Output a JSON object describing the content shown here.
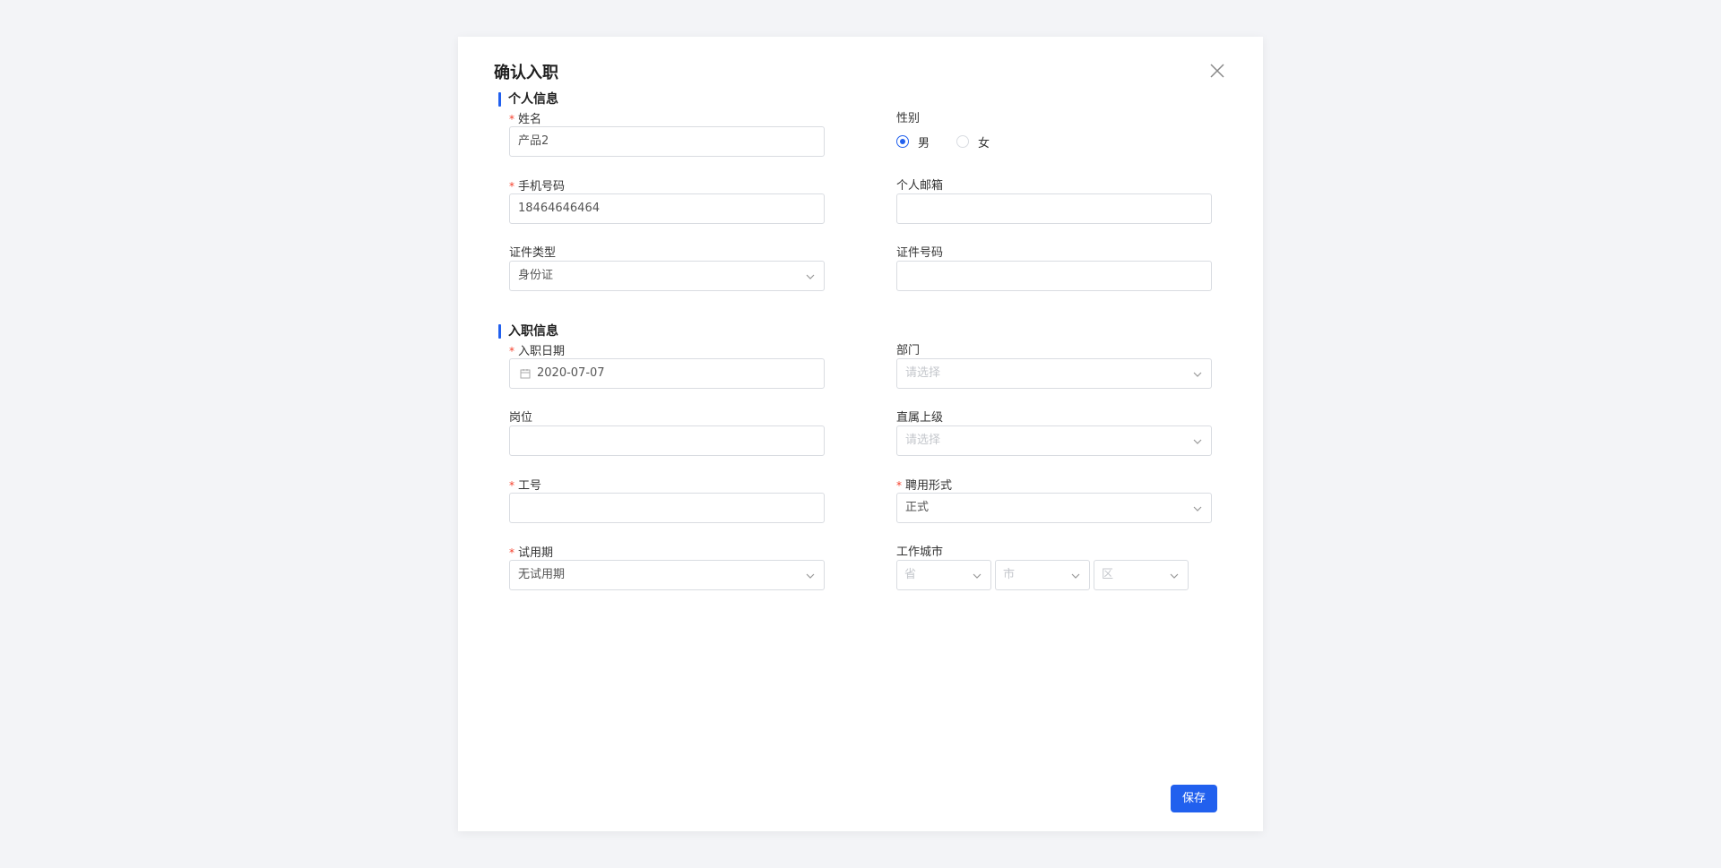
{
  "dialog": {
    "title": "确认入职",
    "save_label": "保存"
  },
  "sections": {
    "personal": "个人信息",
    "employment": "入职信息"
  },
  "fields": {
    "name": {
      "label": "姓名",
      "value": "产品2",
      "required": true
    },
    "gender": {
      "label": "性别",
      "options": [
        "男",
        "女"
      ],
      "selected": "男"
    },
    "phone": {
      "label": "手机号码",
      "value": "18464646464",
      "required": true
    },
    "email": {
      "label": "个人邮箱",
      "value": ""
    },
    "id_type": {
      "label": "证件类型",
      "value": "身份证"
    },
    "id_number": {
      "label": "证件号码",
      "value": ""
    },
    "hire_date": {
      "label": "入职日期",
      "value": "2020-07-07",
      "required": true
    },
    "department": {
      "label": "部门",
      "placeholder": "请选择"
    },
    "position": {
      "label": "岗位",
      "value": ""
    },
    "supervisor": {
      "label": "直属上级",
      "placeholder": "请选择"
    },
    "employee_no": {
      "label": "工号",
      "value": "",
      "required": true
    },
    "employment_type": {
      "label": "聘用形式",
      "value": "正式",
      "required": true
    },
    "probation": {
      "label": "试用期",
      "value": "无试用期",
      "required": true
    },
    "work_city": {
      "label": "工作城市",
      "province_placeholder": "省",
      "city_placeholder": "市",
      "district_placeholder": "区"
    }
  },
  "colors": {
    "accent": "#2160ee",
    "required": "#f5402c",
    "border": "#d9dce1",
    "background": "#f3f4f7"
  },
  "icons": {
    "close": "close-icon",
    "chevron": "chevron-down-icon",
    "calendar": "calendar-icon"
  }
}
